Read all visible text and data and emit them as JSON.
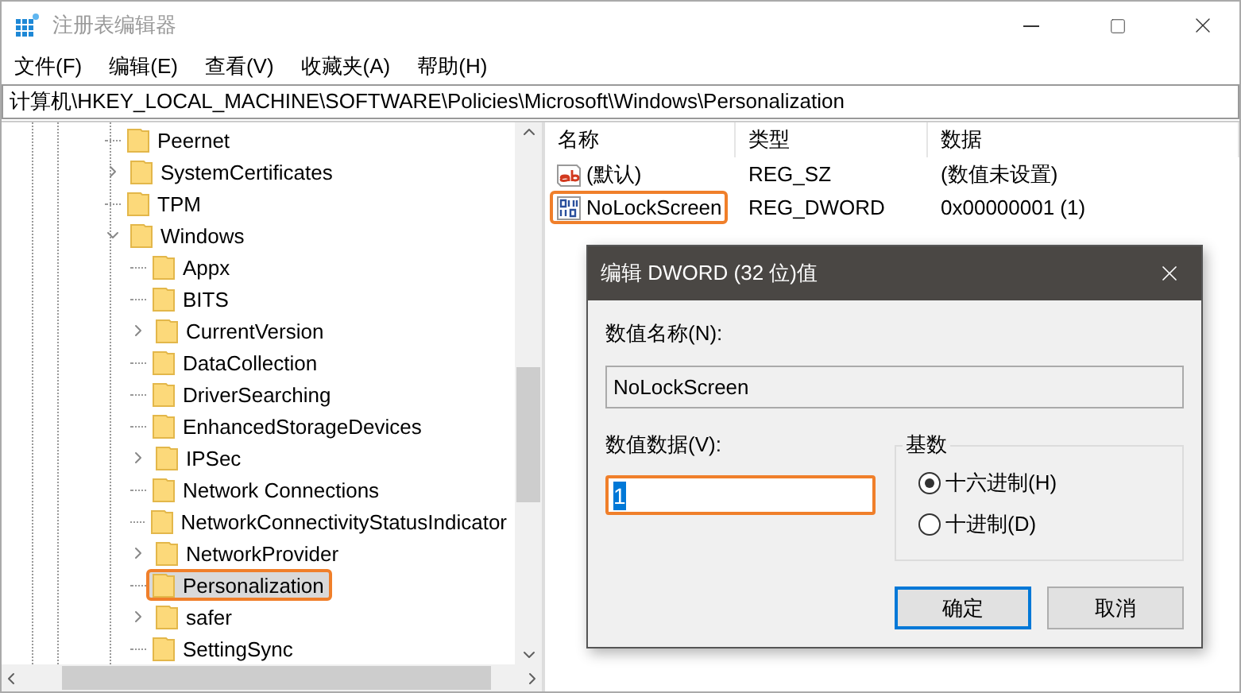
{
  "window": {
    "title": "注册表编辑器"
  },
  "menu": [
    "文件(F)",
    "编辑(E)",
    "查看(V)",
    "收藏夹(A)",
    "帮助(H)"
  ],
  "address": "计算机\\HKEY_LOCAL_MACHINE\\SOFTWARE\\Policies\\Microsoft\\Windows\\Personalization",
  "tree": [
    {
      "label": "Peernet",
      "expandable": false,
      "selected": false,
      "highlighted": false
    },
    {
      "label": "SystemCertificates",
      "expandable": true,
      "expanded": false,
      "selected": false,
      "highlighted": false
    },
    {
      "label": "TPM",
      "expandable": false,
      "selected": false,
      "highlighted": false
    },
    {
      "label": "Windows",
      "expandable": true,
      "expanded": true,
      "selected": false,
      "highlighted": false,
      "children": [
        {
          "label": "Appx",
          "expandable": false,
          "selected": false,
          "highlighted": false
        },
        {
          "label": "BITS",
          "expandable": false,
          "selected": false,
          "highlighted": false
        },
        {
          "label": "CurrentVersion",
          "expandable": true,
          "expanded": false,
          "selected": false,
          "highlighted": false
        },
        {
          "label": "DataCollection",
          "expandable": false,
          "selected": false,
          "highlighted": false
        },
        {
          "label": "DriverSearching",
          "expandable": false,
          "selected": false,
          "highlighted": false
        },
        {
          "label": "EnhancedStorageDevices",
          "expandable": false,
          "selected": false,
          "highlighted": false
        },
        {
          "label": "IPSec",
          "expandable": true,
          "expanded": false,
          "selected": false,
          "highlighted": false
        },
        {
          "label": "Network Connections",
          "expandable": false,
          "selected": false,
          "highlighted": false
        },
        {
          "label": "NetworkConnectivityStatusIndicator",
          "expandable": false,
          "selected": false,
          "highlighted": false
        },
        {
          "label": "NetworkProvider",
          "expandable": true,
          "expanded": false,
          "selected": false,
          "highlighted": false
        },
        {
          "label": "Personalization",
          "expandable": false,
          "selected": true,
          "highlighted": true
        },
        {
          "label": "safer",
          "expandable": true,
          "expanded": false,
          "selected": false,
          "highlighted": false
        },
        {
          "label": "SettingSync",
          "expandable": false,
          "selected": false,
          "highlighted": false
        }
      ]
    }
  ],
  "values": {
    "columns": [
      "名称",
      "类型",
      "数据"
    ],
    "rows": [
      {
        "kind": "string",
        "name": "(默认)",
        "type": "REG_SZ",
        "data": "(数值未设置)",
        "highlighted": false
      },
      {
        "kind": "binary",
        "name": "NoLockScreen",
        "type": "REG_DWORD",
        "data": "0x00000001 (1)",
        "highlighted": true
      }
    ]
  },
  "dialog": {
    "title": "编辑 DWORD (32 位)值",
    "name_label": "数值名称(N):",
    "name_value": "NoLockScreen",
    "data_label": "数值数据(V):",
    "data_value": "1",
    "data_highlighted": true,
    "base_label": "基数",
    "bases": [
      {
        "label": "十六进制(H)",
        "selected": true
      },
      {
        "label": "十进制(D)",
        "selected": false
      }
    ],
    "buttons": [
      {
        "label": "确定",
        "default": true
      },
      {
        "label": "取消",
        "default": false
      }
    ]
  }
}
